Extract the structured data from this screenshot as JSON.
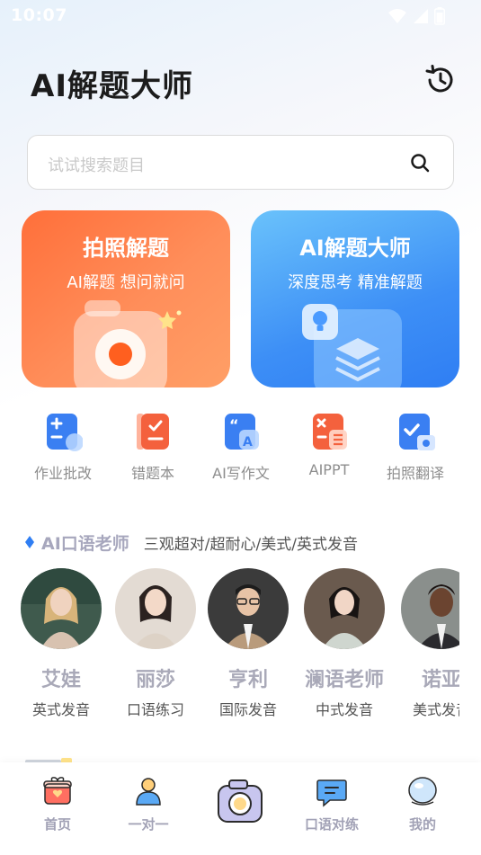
{
  "status_bar": {
    "time": "10:07"
  },
  "header": {
    "title": "AI解题大师"
  },
  "search": {
    "placeholder": "试试搜索题目"
  },
  "cards": {
    "photo": {
      "title": "拍照解题",
      "subtitle": "AI解题  想问就问"
    },
    "ai": {
      "title": "AI解题大师",
      "subtitle": "深度思考  精准解题"
    }
  },
  "tools": [
    {
      "label": "作业批改",
      "icon": "homework-check-icon",
      "color": "#3a7ff2"
    },
    {
      "label": "错题本",
      "icon": "mistake-book-icon",
      "color": "#f4613d"
    },
    {
      "label": "AI写作文",
      "icon": "ai-essay-icon",
      "color": "#3a7ff2"
    },
    {
      "label": "AIPPT",
      "icon": "ai-ppt-icon",
      "color": "#f4613d"
    },
    {
      "label": "拍照翻译",
      "icon": "photo-translate-icon",
      "color": "#3a7ff2"
    }
  ],
  "section": {
    "title": "AI口语老师",
    "description": "三观超对/超耐心/美式/英式发音"
  },
  "teachers": [
    {
      "name": "艾娃",
      "tag": "英式发音"
    },
    {
      "name": "丽莎",
      "tag": "口语练习"
    },
    {
      "name": "亨利",
      "tag": "国际发音"
    },
    {
      "name": "澜语老师",
      "tag": "中式发音"
    },
    {
      "name": "诺亚",
      "tag": "美式发音"
    }
  ],
  "tabbar": {
    "items": [
      {
        "label": "首页",
        "icon": "gift-home-icon"
      },
      {
        "label": "一对一",
        "icon": "person-icon"
      },
      {
        "label": "",
        "icon": "camera-icon"
      },
      {
        "label": "口语对练",
        "icon": "chat-icon"
      },
      {
        "label": "我的",
        "icon": "profile-icon"
      }
    ]
  },
  "colors": {
    "accent_orange": "#ff7a45",
    "accent_blue": "#3d8ff6",
    "tab_label": "#a2a2b6"
  }
}
